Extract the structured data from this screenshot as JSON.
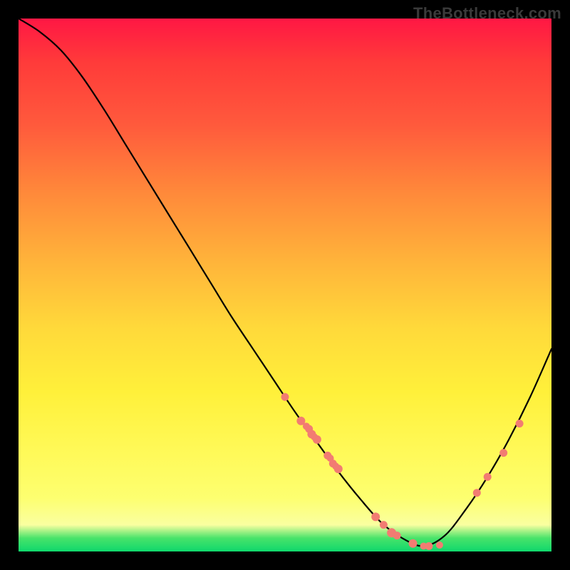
{
  "watermark": "TheBottleneck.com",
  "chart_data": {
    "type": "line",
    "title": "",
    "xlabel": "",
    "ylabel": "",
    "xlim": [
      0,
      100
    ],
    "ylim": [
      0,
      100
    ],
    "grid": false,
    "legend": false,
    "series": [
      {
        "name": "curve",
        "color": "#000000",
        "x": [
          0,
          4,
          8,
          12,
          16,
          20,
          24,
          28,
          32,
          36,
          40,
          44,
          48,
          52,
          56,
          60,
          64,
          68,
          72,
          76,
          80,
          84,
          88,
          92,
          96,
          100
        ],
        "y": [
          100,
          97.5,
          94,
          89,
          83,
          76.5,
          70,
          63.5,
          57,
          50.5,
          44,
          38,
          32,
          26,
          20.5,
          15,
          10,
          5.5,
          2.5,
          1,
          3,
          8,
          14,
          21,
          29,
          38
        ]
      },
      {
        "name": "points",
        "color": "#f27c72",
        "type": "scatter",
        "x": [
          50,
          53,
          54,
          54.5,
          55,
          55.5,
          56,
          58,
          58.5,
          59,
          59.5,
          60,
          67,
          68.5,
          70,
          71,
          74,
          76,
          77,
          79,
          86,
          88,
          91,
          94
        ],
        "y": [
          29,
          24.5,
          23.5,
          23,
          22,
          21.5,
          21,
          18,
          17.5,
          16.5,
          16,
          15.5,
          6.5,
          5,
          3.5,
          3,
          1.5,
          1,
          1,
          1.2,
          11,
          14,
          18.5,
          24
        ],
        "sizes": [
          5.5,
          6,
          5,
          5.5,
          6,
          5,
          6,
          5.5,
          5,
          5.5,
          5,
          6,
          6,
          5.5,
          6.5,
          5.5,
          6,
          5,
          5.5,
          5,
          5.5,
          5.5,
          5.5,
          5.5
        ]
      }
    ]
  }
}
